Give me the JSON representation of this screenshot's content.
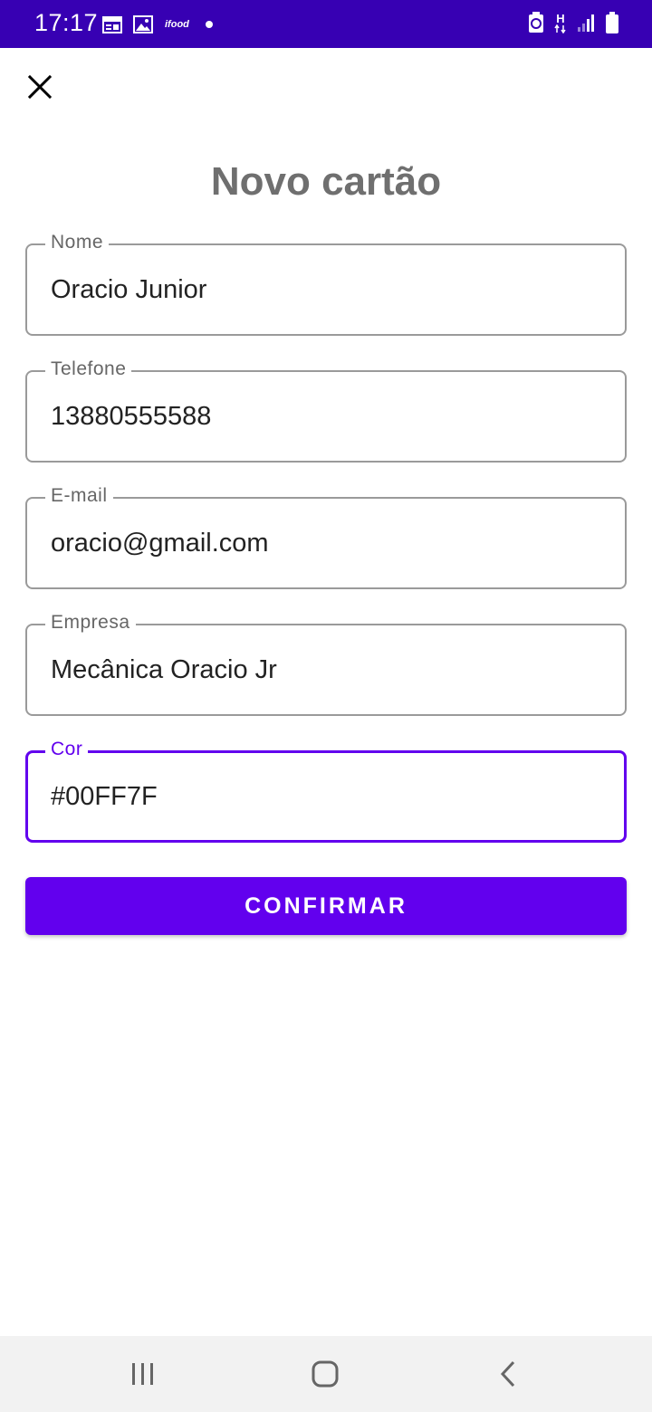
{
  "status_bar": {
    "time": "17:17",
    "brand_icon_text": "ifood",
    "left_icons": [
      "calendar-icon",
      "image-icon",
      "ifood-icon",
      "notification-dot"
    ],
    "right_icons": [
      "battery-saver-icon",
      "network-h-icon",
      "signal-icon",
      "battery-icon"
    ],
    "network_text": "H",
    "background_color": "#3700b3"
  },
  "header": {
    "close_icon": "close-icon",
    "title": "Novo cartão"
  },
  "form": {
    "fields": [
      {
        "label": "Nome",
        "value": "Oracio Junior"
      },
      {
        "label": "Telefone",
        "value": "13880555588"
      },
      {
        "label": "E-mail",
        "value": "oracio@gmail.com"
      },
      {
        "label": "Empresa",
        "value": "Mecânica Oracio Jr"
      },
      {
        "label": "Cor",
        "value": "#00FF7F",
        "focused": true
      }
    ],
    "confirm_label": "CONFIRMAR",
    "accent_color": "#6200ee"
  },
  "nav_bar": {
    "buttons": [
      "recent-apps-icon",
      "home-icon",
      "back-icon"
    ]
  }
}
